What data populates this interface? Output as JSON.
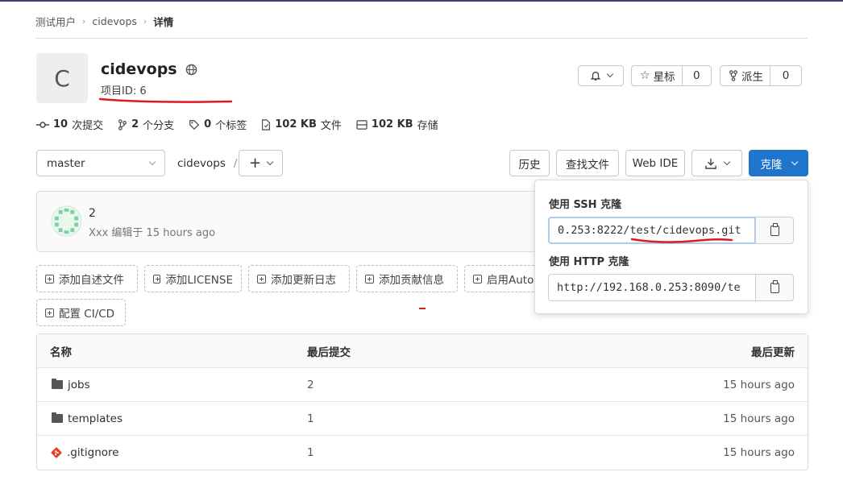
{
  "breadcrumb": {
    "items": [
      "测试用户",
      "cidevops",
      "详情"
    ]
  },
  "project": {
    "avatar_letter": "C",
    "name": "cidevops",
    "id_label": "项目ID: 6"
  },
  "actions": {
    "star_label": "星标",
    "star_count": "0",
    "fork_label": "派生",
    "fork_count": "0"
  },
  "stats": {
    "commits_count": "10",
    "commits_label": "次提交",
    "branches_count": "2",
    "branches_label": "个分支",
    "tags_count": "0",
    "tags_label": "个标签",
    "files_size": "102 KB",
    "files_label": "文件",
    "storage_size": "102 KB",
    "storage_label": "存储"
  },
  "toolbar": {
    "branch": "master",
    "path": "cidevops",
    "path_sep": "/",
    "add": "+",
    "history": "历史",
    "find_file": "查找文件",
    "web_ide": "Web IDE",
    "clone": "克隆"
  },
  "commit": {
    "message": "2",
    "author_line": "Xxx 编辑于 15 hours ago"
  },
  "quick_actions": [
    "添加自述文件",
    "添加LICENSE",
    "添加更新日志",
    "添加贡献信息",
    "启用Auto",
    "配置 CI/CD"
  ],
  "clone_popup": {
    "ssh_label": "使用 SSH 克隆",
    "ssh_url": "0.253:8222/test/cidevops.git",
    "http_label": "使用 HTTP 克隆",
    "http_url": "http://192.168.0.253:8090/te"
  },
  "table": {
    "headers": {
      "name": "名称",
      "last_commit": "最后提交",
      "last_update": "最后更新"
    },
    "rows": [
      {
        "name": "jobs",
        "commit": "2",
        "updated": "15 hours ago",
        "type": "folder"
      },
      {
        "name": "templates",
        "commit": "1",
        "updated": "15 hours ago",
        "type": "folder"
      },
      {
        "name": ".gitignore",
        "commit": "1",
        "updated": "15 hours ago",
        "type": "git-file"
      }
    ]
  },
  "colors": {
    "primary": "#1f75cb",
    "annotation_red": "#e0191e"
  }
}
